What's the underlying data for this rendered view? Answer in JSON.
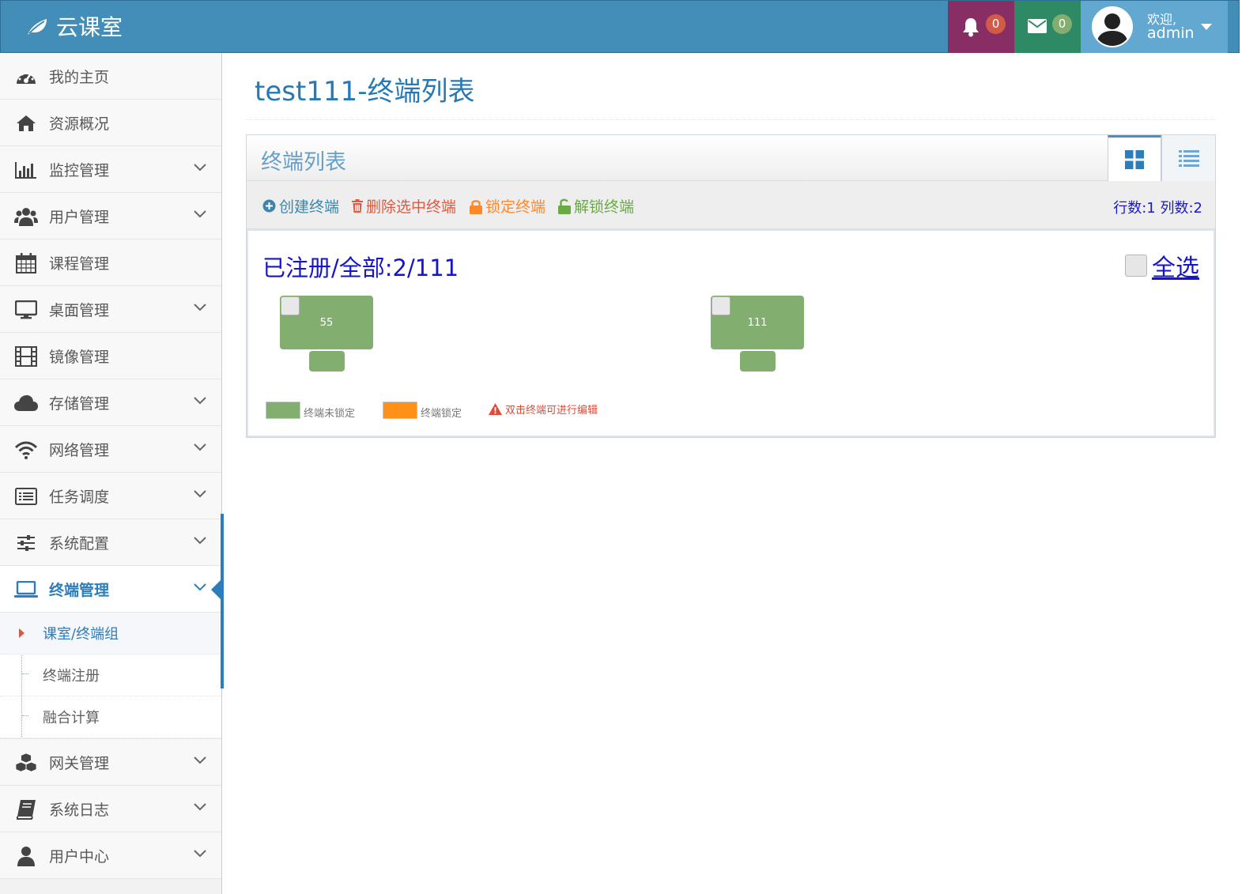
{
  "navbar": {
    "brand": "云课室",
    "notifications_count": "0",
    "messages_count": "0",
    "welcome": "欢迎,",
    "username": "admin",
    "colors": {
      "bar": "#438eb9",
      "notifications": "#892e65",
      "messages": "#2e8965",
      "user": "#62a8d1"
    }
  },
  "sidebar": {
    "items": [
      {
        "label": "我的主页",
        "icon": "dashboard-icon",
        "has_submenu": false
      },
      {
        "label": "资源概况",
        "icon": "home-icon",
        "has_submenu": false
      },
      {
        "label": "监控管理",
        "icon": "bar-chart-icon",
        "has_submenu": true
      },
      {
        "label": "用户管理",
        "icon": "users-icon",
        "has_submenu": true
      },
      {
        "label": "课程管理",
        "icon": "calendar-icon",
        "has_submenu": false
      },
      {
        "label": "桌面管理",
        "icon": "desktop-icon",
        "has_submenu": true
      },
      {
        "label": "镜像管理",
        "icon": "film-icon",
        "has_submenu": false
      },
      {
        "label": "存储管理",
        "icon": "cloud-icon",
        "has_submenu": true
      },
      {
        "label": "网络管理",
        "icon": "wifi-icon",
        "has_submenu": true
      },
      {
        "label": "任务调度",
        "icon": "list-alt-icon",
        "has_submenu": true
      },
      {
        "label": "系统配置",
        "icon": "sliders-icon",
        "has_submenu": true
      },
      {
        "label": "终端管理",
        "icon": "laptop-icon",
        "has_submenu": true,
        "active": true
      },
      {
        "label": "网关管理",
        "icon": "cubes-icon",
        "has_submenu": true
      },
      {
        "label": "系统日志",
        "icon": "book-icon",
        "has_submenu": true
      },
      {
        "label": "用户中心",
        "icon": "user-icon",
        "has_submenu": true
      }
    ],
    "terminal_submenu": [
      {
        "label": "课室/终端组",
        "current": true
      },
      {
        "label": "终端注册",
        "current": false
      },
      {
        "label": "融合计算",
        "current": false
      }
    ]
  },
  "page": {
    "title": "test111-终端列表",
    "widget_title": "终端列表",
    "toolbar": {
      "create": "创建终端",
      "delete": "删除选中终端",
      "lock": "锁定终端",
      "unlock": "解锁终端",
      "grid_size": "行数:1 列数:2"
    },
    "registered_summary": "已注册/全部:2/111",
    "select_all": "全选",
    "terminals": [
      {
        "name": "55",
        "locked": false,
        "checked": false
      },
      {
        "name": "111",
        "locked": false,
        "checked": false
      }
    ],
    "legend": {
      "unlocked": "终端未锁定",
      "locked": "终端锁定",
      "hint": "双击终端可进行编辑",
      "colors": {
        "unlocked": "#82af6f",
        "locked": "#ff9018"
      }
    },
    "active_view": "grid"
  }
}
